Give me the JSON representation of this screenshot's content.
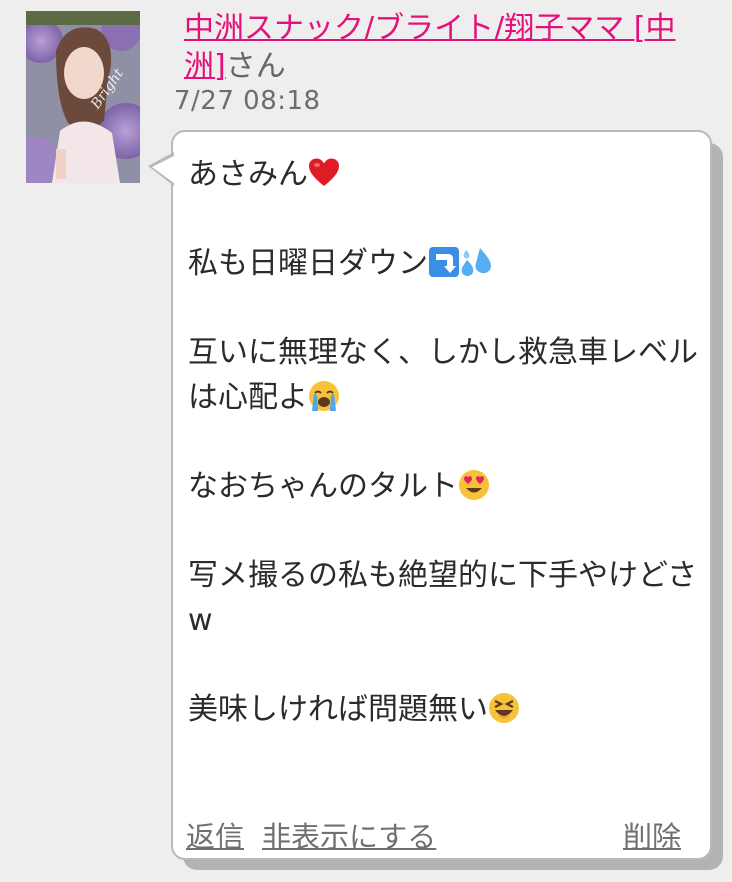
{
  "post": {
    "sender_name": "中洲スナック/ブライト/翔子ママ [中洲]",
    "sender_suffix": "さん",
    "timestamp": "7/27 08:18",
    "avatar_signature": "Bright",
    "message": [
      {
        "text": "あさみん",
        "emoji": "red-heart-icon"
      },
      {
        "text": "私も日曜日ダウン",
        "emoji": [
          "down-arrow-icon",
          "sweat-droplets-icon"
        ]
      },
      {
        "text": "互いに無理なく、しかし救急車レベルは心配よ",
        "emoji": "loudly-crying-face-icon"
      },
      {
        "text": "なおちゃんのタルト",
        "emoji": "heart-eyes-face-icon"
      },
      {
        "text": "写メ撮るの私も絶望的に下手やけどさw",
        "emoji": null
      },
      {
        "text": "美味しければ問題無い",
        "emoji": "laughing-face-icon"
      }
    ]
  },
  "actions": {
    "reply_label": "返信",
    "hide_label": "非表示にする",
    "delete_label": "削除"
  },
  "colors": {
    "sender_link": "#e3127a",
    "background": "#eeeeee",
    "bubble": "#ffffff",
    "action_link": "#707070"
  }
}
